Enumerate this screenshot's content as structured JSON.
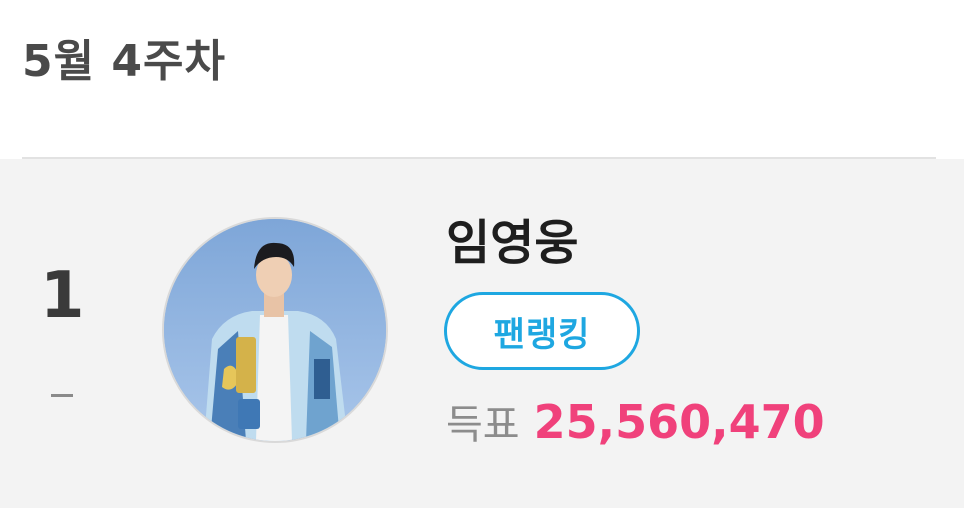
{
  "header": {
    "week_title": "5월 4주차"
  },
  "ranking": {
    "rank": "1",
    "change": "-",
    "artist_name": "임영웅",
    "badge_label": "팬랭킹",
    "votes_label": "득표",
    "votes_count": "25,560,470"
  },
  "colors": {
    "badge_accent": "#1ea7e1",
    "votes_count": "#f0417b",
    "card_background": "#f3f3f3"
  }
}
